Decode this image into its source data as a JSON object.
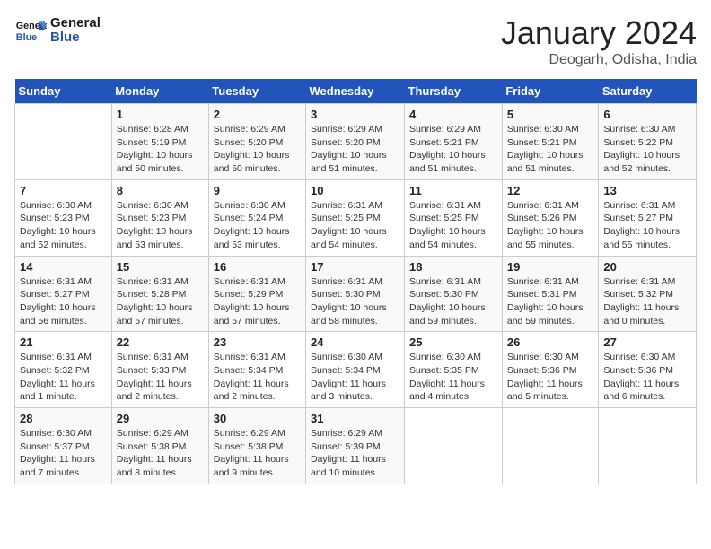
{
  "logo": {
    "text_general": "General",
    "text_blue": "Blue"
  },
  "title": "January 2024",
  "subtitle": "Deogarh, Odisha, India",
  "days_header": [
    "Sunday",
    "Monday",
    "Tuesday",
    "Wednesday",
    "Thursday",
    "Friday",
    "Saturday"
  ],
  "weeks": [
    [
      {
        "day": "",
        "info": ""
      },
      {
        "day": "1",
        "info": "Sunrise: 6:28 AM\nSunset: 5:19 PM\nDaylight: 10 hours\nand 50 minutes."
      },
      {
        "day": "2",
        "info": "Sunrise: 6:29 AM\nSunset: 5:20 PM\nDaylight: 10 hours\nand 50 minutes."
      },
      {
        "day": "3",
        "info": "Sunrise: 6:29 AM\nSunset: 5:20 PM\nDaylight: 10 hours\nand 51 minutes."
      },
      {
        "day": "4",
        "info": "Sunrise: 6:29 AM\nSunset: 5:21 PM\nDaylight: 10 hours\nand 51 minutes."
      },
      {
        "day": "5",
        "info": "Sunrise: 6:30 AM\nSunset: 5:21 PM\nDaylight: 10 hours\nand 51 minutes."
      },
      {
        "day": "6",
        "info": "Sunrise: 6:30 AM\nSunset: 5:22 PM\nDaylight: 10 hours\nand 52 minutes."
      }
    ],
    [
      {
        "day": "7",
        "info": "Sunrise: 6:30 AM\nSunset: 5:23 PM\nDaylight: 10 hours\nand 52 minutes."
      },
      {
        "day": "8",
        "info": "Sunrise: 6:30 AM\nSunset: 5:23 PM\nDaylight: 10 hours\nand 53 minutes."
      },
      {
        "day": "9",
        "info": "Sunrise: 6:30 AM\nSunset: 5:24 PM\nDaylight: 10 hours\nand 53 minutes."
      },
      {
        "day": "10",
        "info": "Sunrise: 6:31 AM\nSunset: 5:25 PM\nDaylight: 10 hours\nand 54 minutes."
      },
      {
        "day": "11",
        "info": "Sunrise: 6:31 AM\nSunset: 5:25 PM\nDaylight: 10 hours\nand 54 minutes."
      },
      {
        "day": "12",
        "info": "Sunrise: 6:31 AM\nSunset: 5:26 PM\nDaylight: 10 hours\nand 55 minutes."
      },
      {
        "day": "13",
        "info": "Sunrise: 6:31 AM\nSunset: 5:27 PM\nDaylight: 10 hours\nand 55 minutes."
      }
    ],
    [
      {
        "day": "14",
        "info": "Sunrise: 6:31 AM\nSunset: 5:27 PM\nDaylight: 10 hours\nand 56 minutes."
      },
      {
        "day": "15",
        "info": "Sunrise: 6:31 AM\nSunset: 5:28 PM\nDaylight: 10 hours\nand 57 minutes."
      },
      {
        "day": "16",
        "info": "Sunrise: 6:31 AM\nSunset: 5:29 PM\nDaylight: 10 hours\nand 57 minutes."
      },
      {
        "day": "17",
        "info": "Sunrise: 6:31 AM\nSunset: 5:30 PM\nDaylight: 10 hours\nand 58 minutes."
      },
      {
        "day": "18",
        "info": "Sunrise: 6:31 AM\nSunset: 5:30 PM\nDaylight: 10 hours\nand 59 minutes."
      },
      {
        "day": "19",
        "info": "Sunrise: 6:31 AM\nSunset: 5:31 PM\nDaylight: 10 hours\nand 59 minutes."
      },
      {
        "day": "20",
        "info": "Sunrise: 6:31 AM\nSunset: 5:32 PM\nDaylight: 11 hours\nand 0 minutes."
      }
    ],
    [
      {
        "day": "21",
        "info": "Sunrise: 6:31 AM\nSunset: 5:32 PM\nDaylight: 11 hours\nand 1 minute."
      },
      {
        "day": "22",
        "info": "Sunrise: 6:31 AM\nSunset: 5:33 PM\nDaylight: 11 hours\nand 2 minutes."
      },
      {
        "day": "23",
        "info": "Sunrise: 6:31 AM\nSunset: 5:34 PM\nDaylight: 11 hours\nand 2 minutes."
      },
      {
        "day": "24",
        "info": "Sunrise: 6:30 AM\nSunset: 5:34 PM\nDaylight: 11 hours\nand 3 minutes."
      },
      {
        "day": "25",
        "info": "Sunrise: 6:30 AM\nSunset: 5:35 PM\nDaylight: 11 hours\nand 4 minutes."
      },
      {
        "day": "26",
        "info": "Sunrise: 6:30 AM\nSunset: 5:36 PM\nDaylight: 11 hours\nand 5 minutes."
      },
      {
        "day": "27",
        "info": "Sunrise: 6:30 AM\nSunset: 5:36 PM\nDaylight: 11 hours\nand 6 minutes."
      }
    ],
    [
      {
        "day": "28",
        "info": "Sunrise: 6:30 AM\nSunset: 5:37 PM\nDaylight: 11 hours\nand 7 minutes."
      },
      {
        "day": "29",
        "info": "Sunrise: 6:29 AM\nSunset: 5:38 PM\nDaylight: 11 hours\nand 8 minutes."
      },
      {
        "day": "30",
        "info": "Sunrise: 6:29 AM\nSunset: 5:38 PM\nDaylight: 11 hours\nand 9 minutes."
      },
      {
        "day": "31",
        "info": "Sunrise: 6:29 AM\nSunset: 5:39 PM\nDaylight: 11 hours\nand 10 minutes."
      },
      {
        "day": "",
        "info": ""
      },
      {
        "day": "",
        "info": ""
      },
      {
        "day": "",
        "info": ""
      }
    ]
  ]
}
